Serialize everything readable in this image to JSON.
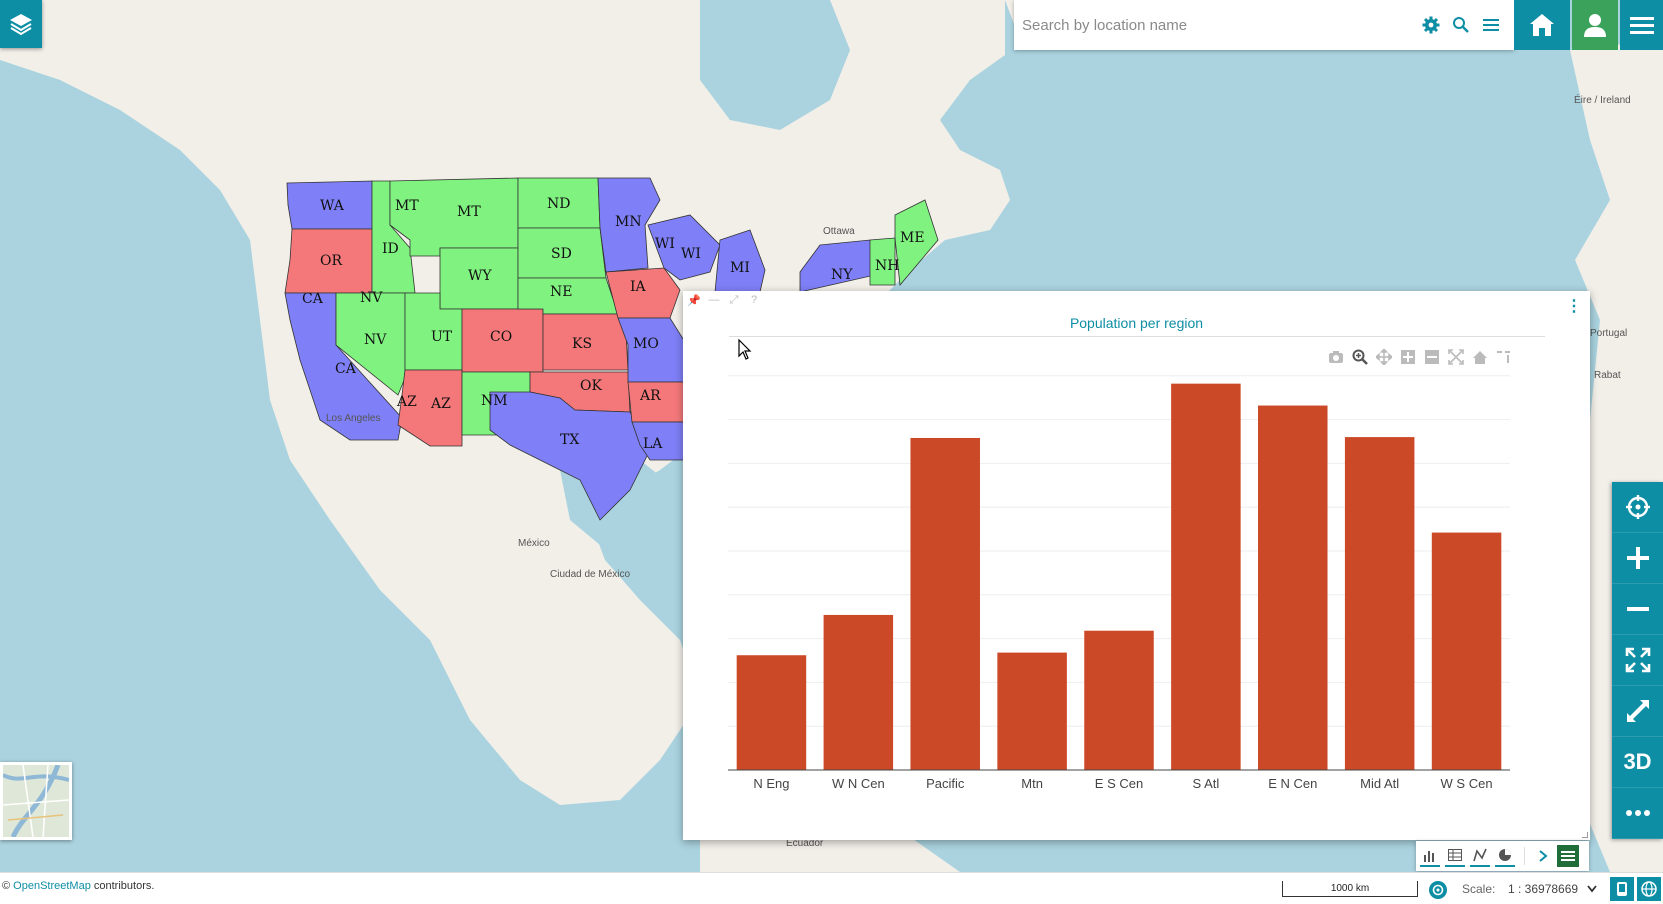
{
  "search": {
    "placeholder": "Search by location name"
  },
  "map": {
    "states": [
      {
        "abbr": "WA",
        "color": "#7f7ff7"
      },
      {
        "abbr": "OR",
        "color": "#f4787a"
      },
      {
        "abbr": "CA",
        "color": "#7f7ff7"
      },
      {
        "abbr": "ID",
        "color": "#80f280"
      },
      {
        "abbr": "NV",
        "color": "#80f280"
      },
      {
        "abbr": "MT",
        "color": "#80f280"
      },
      {
        "abbr": "WY",
        "color": "#80f280"
      },
      {
        "abbr": "UT",
        "color": "#80f280"
      },
      {
        "abbr": "CO",
        "color": "#f4787a"
      },
      {
        "abbr": "AZ",
        "color": "#f4787a"
      },
      {
        "abbr": "NM",
        "color": "#80f280"
      },
      {
        "abbr": "ND",
        "color": "#80f280"
      },
      {
        "abbr": "SD",
        "color": "#80f280"
      },
      {
        "abbr": "NE",
        "color": "#80f280"
      },
      {
        "abbr": "KS",
        "color": "#f4787a"
      },
      {
        "abbr": "OK",
        "color": "#f4787a"
      },
      {
        "abbr": "TX",
        "color": "#7f7ff7"
      },
      {
        "abbr": "MN",
        "color": "#7f7ff7"
      },
      {
        "abbr": "IA",
        "color": "#f4787a"
      },
      {
        "abbr": "MO",
        "color": "#7f7ff7"
      },
      {
        "abbr": "AR",
        "color": "#f4787a"
      },
      {
        "abbr": "LA",
        "color": "#7f7ff7"
      },
      {
        "abbr": "WI",
        "color": "#7f7ff7"
      },
      {
        "abbr": "MI",
        "color": "#7f7ff7"
      },
      {
        "abbr": "NY",
        "color": "#7f7ff7"
      },
      {
        "abbr": "NH",
        "color": "#80f280"
      },
      {
        "abbr": "ME",
        "color": "#80f280"
      }
    ],
    "places": [
      "Ottawa",
      "Los Angeles",
      "México",
      "Ciudad de México",
      "Ecuador",
      "Éire / Ireland",
      "Portugal",
      "Rabat"
    ]
  },
  "chart_panel": {
    "menu_glyph": "⋮"
  },
  "chart_data": {
    "type": "bar",
    "title": "Population per region",
    "categories": [
      "N Eng",
      "W N Cen",
      "Pacific",
      "Mtn",
      "E S Cen",
      "S Atl",
      "E N Cen",
      "Mid Atl",
      "W S Cen"
    ],
    "values": [
      13.1,
      17.7,
      37.9,
      13.4,
      15.9,
      44.1,
      41.6,
      38.0,
      27.1
    ],
    "ylim": [
      0,
      46
    ],
    "color": "#cc4928",
    "grid": true
  },
  "right_toolbar": {
    "three_d_label": "3D"
  },
  "status_bar": {
    "attribution_prefix": "©",
    "attribution_link": "OpenStreetMap",
    "attribution_suffix": "contributors.",
    "scalebar_label": "1000 km",
    "scale_label": "Scale:",
    "scale_value": "1 : 36978669"
  },
  "colors": {
    "accent": "#0e8ea5",
    "user": "#3aa25a",
    "bar": "#cc4928"
  }
}
